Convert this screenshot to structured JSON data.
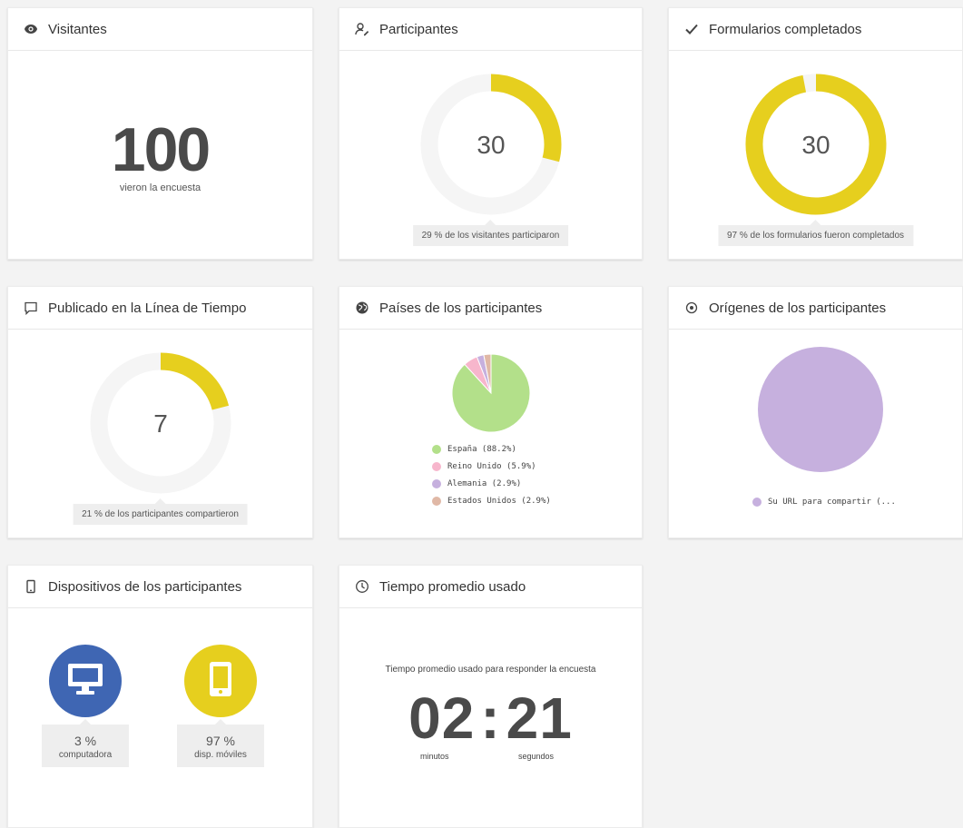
{
  "cards": {
    "visitors": {
      "title": "Visitantes",
      "icon": "eye-icon",
      "value": "100",
      "caption": "vieron la encuesta"
    },
    "participants": {
      "title": "Participantes",
      "icon": "user-edit-icon",
      "value": "30",
      "fraction": 0.29,
      "tooltip": "29 % de los visitantes participaron"
    },
    "completed": {
      "title": "Formularios completados",
      "icon": "check-icon",
      "value": "30",
      "fraction": 0.97,
      "tooltip": "97 % de los formularios fueron completados"
    },
    "timeline": {
      "title": "Publicado en la Línea de Tiempo",
      "icon": "comment-icon",
      "value": "7",
      "fraction": 0.21,
      "tooltip": "21 % de los participantes compartieron"
    },
    "countries": {
      "title": "Países de los participantes",
      "icon": "globe-icon",
      "legend": [
        {
          "label": "España (88.2%)",
          "color": "#b3e08a",
          "fraction": 0.882
        },
        {
          "label": "Reino Unido (5.9%)",
          "color": "#f7b6cc",
          "fraction": 0.059
        },
        {
          "label": "Alemania (2.9%)",
          "color": "#c6b0de",
          "fraction": 0.029
        },
        {
          "label": "Estados Unidos (2.9%)",
          "color": "#e0b8a6",
          "fraction": 0.03
        }
      ]
    },
    "origins": {
      "title": "Orígenes de los participantes",
      "icon": "target-icon",
      "legend": [
        {
          "label": "Su URL para compartir (...",
          "color": "#c6b0de",
          "fraction": 1.0
        }
      ]
    },
    "devices": {
      "title": "Dispositivos de los participantes",
      "icon": "mobile-icon",
      "items": [
        {
          "pct": "3 %",
          "label": "computadora",
          "icon": "desktop-icon",
          "color": "#3f66b3"
        },
        {
          "pct": "97 %",
          "label": "disp. móviles",
          "icon": "tablet-icon",
          "color": "#e6cf1e"
        }
      ]
    },
    "avgtime": {
      "title": "Tiempo promedio usado",
      "icon": "clock-icon",
      "caption": "Tiempo promedio usado para responder la encuesta",
      "minutes": "02",
      "separator": ":",
      "seconds": "21",
      "minutes_label": "minutos",
      "seconds_label": "segundos"
    }
  },
  "colors": {
    "accent": "#e6cf1e",
    "track": "#f5f5f5"
  }
}
